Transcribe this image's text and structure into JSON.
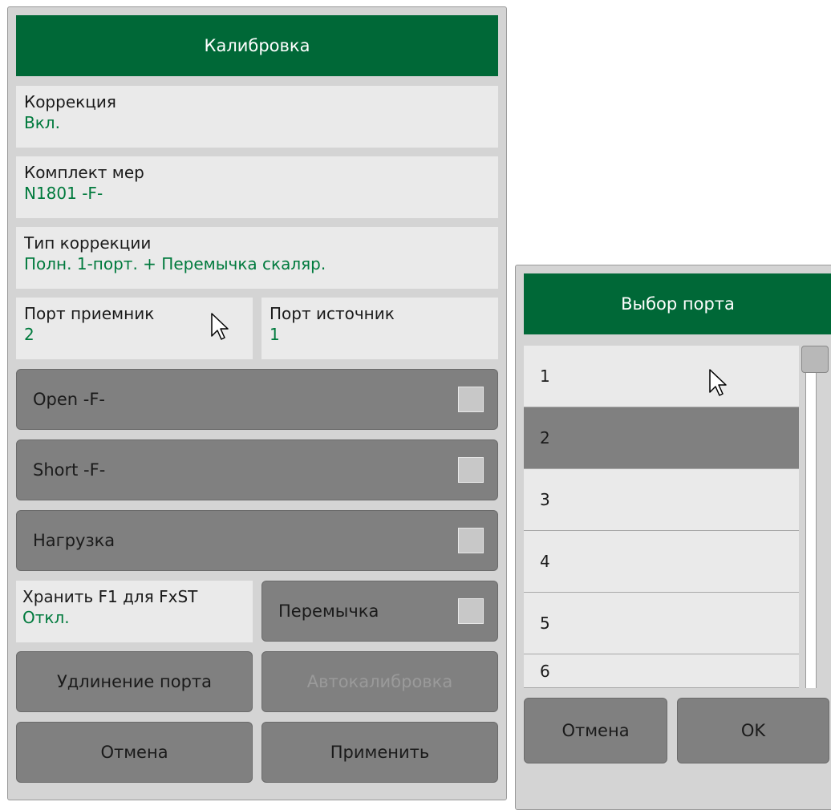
{
  "calibration_panel": {
    "title": "Калибровка",
    "correction": {
      "label": "Коррекция",
      "value": "Вкл."
    },
    "cal_kit": {
      "label": "Комплект мер",
      "value": "N1801 -F-"
    },
    "correction_type": {
      "label": "Тип коррекции",
      "value": "Полн. 1-порт. + Перемычка скаляр."
    },
    "receiver_port": {
      "label": "Порт приемник",
      "value": "2"
    },
    "source_port": {
      "label": "Порт источник",
      "value": "1"
    },
    "standards": [
      {
        "label": "Open -F-"
      },
      {
        "label": "Short -F-"
      },
      {
        "label": "Нагрузка"
      }
    ],
    "store_f1": {
      "label": "Хранить F1 для FxST",
      "value": "Откл."
    },
    "thru": {
      "label": "Перемычка"
    },
    "port_extension_label": "Удлинение порта",
    "autocal_label": "Автокалибровка",
    "cancel_label": "Отмена",
    "apply_label": "Применить"
  },
  "port_select_panel": {
    "title": "Выбор порта",
    "items": [
      "1",
      "2",
      "3",
      "4",
      "5",
      "6"
    ],
    "selected": "2",
    "cancel_label": "Отмена",
    "ok_label": "OK"
  },
  "colors": {
    "header_green": "#006837",
    "value_green": "#007a3d",
    "button_gray": "#808080",
    "panel_gray": "#d4d4d4",
    "field_bg": "#eaeaea"
  }
}
